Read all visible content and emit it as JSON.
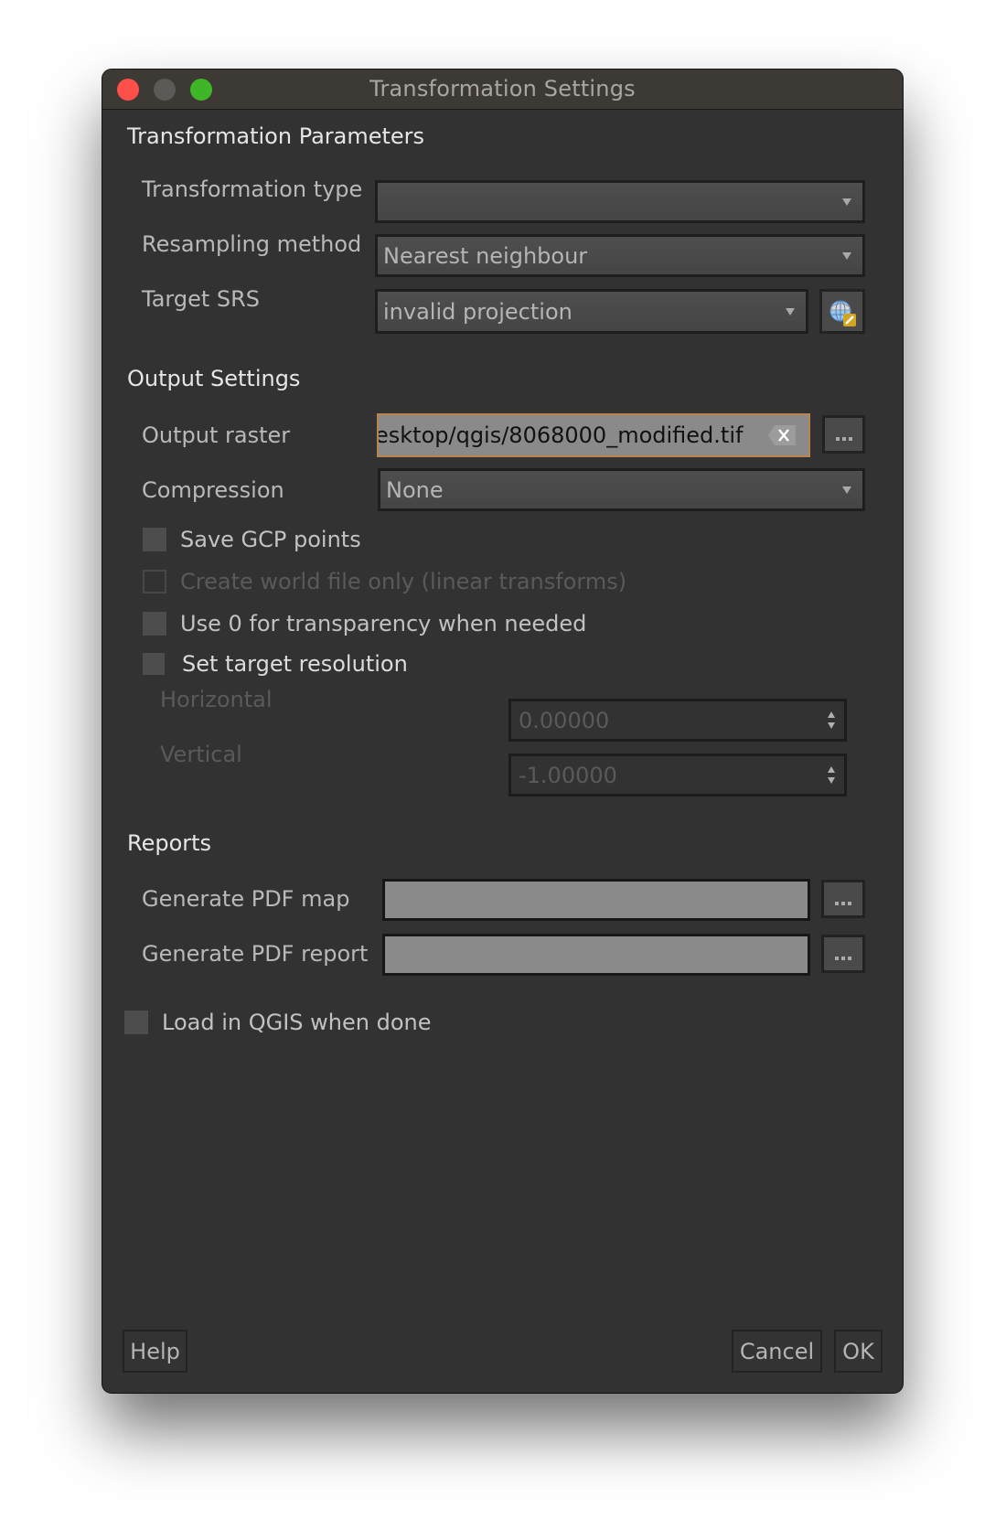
{
  "window": {
    "title": "Transformation Settings",
    "traffic_lights": [
      "close",
      "minimize",
      "maximize"
    ]
  },
  "transformation_parameters": {
    "heading": "Transformation Parameters",
    "transformation_type": {
      "label": "Transformation type",
      "value": ""
    },
    "resampling_method": {
      "label": "Resampling method",
      "value": "Nearest neighbour"
    },
    "target_srs": {
      "label": "Target SRS",
      "value": "invalid projection",
      "button_icon": "globe-edit-icon"
    }
  },
  "output_settings": {
    "heading": "Output Settings",
    "output_raster": {
      "label": "Output raster",
      "value": "esktop/qgis/8068000_modified.tif",
      "browse_label": "..."
    },
    "compression": {
      "label": "Compression",
      "value": "None"
    },
    "checkboxes": [
      {
        "label": "Save GCP points",
        "checked": false,
        "enabled": true
      },
      {
        "label": "Create world file only (linear transforms)",
        "checked": false,
        "enabled": false
      },
      {
        "label": "Use 0 for transparency when needed",
        "checked": false,
        "enabled": true
      },
      {
        "label": "Set target resolution",
        "checked": false,
        "enabled": true
      }
    ],
    "horizontal": {
      "label": "Horizontal",
      "value": "0.00000"
    },
    "vertical": {
      "label": "Vertical",
      "value": "-1.00000"
    }
  },
  "reports": {
    "heading": "Reports",
    "pdf_map": {
      "label": "Generate PDF map",
      "value": "",
      "browse_label": "..."
    },
    "pdf_report": {
      "label": "Generate PDF report",
      "value": "",
      "browse_label": "..."
    }
  },
  "load_in_qgis": {
    "label": "Load in QGIS when done",
    "checked": false
  },
  "buttons": {
    "help": "Help",
    "cancel": "Cancel",
    "ok": "OK"
  },
  "colors": {
    "window_bg": "#323232",
    "titlebar_bg": "#3d3935",
    "focus_border": "#b9844d",
    "close": "#fe4f4a",
    "minimize": "#5c5957",
    "maximize": "#3fb627"
  }
}
